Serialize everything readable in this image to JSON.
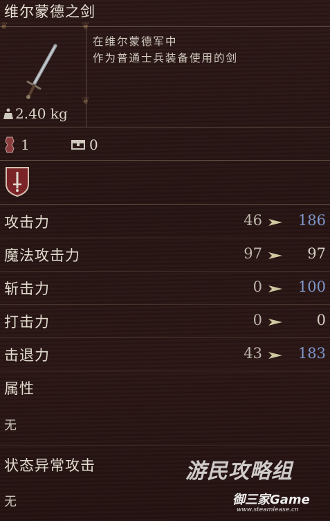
{
  "item": {
    "name": "维尔蒙德之剑",
    "description_lines": [
      "在维尔蒙德军中",
      "作为普通士兵装备使用的剑"
    ],
    "weight": "2.40 kg",
    "slots": {
      "hand_count": "1",
      "storage_count": "0"
    },
    "class_icon": "sword-emblem-icon"
  },
  "stats": [
    {
      "label": "攻击力",
      "base": "46",
      "upgraded": "186",
      "improved": true
    },
    {
      "label": "魔法攻击力",
      "base": "97",
      "upgraded": "97",
      "improved": false
    },
    {
      "label": "斩击力",
      "base": "0",
      "upgraded": "100",
      "improved": true
    },
    {
      "label": "打击力",
      "base": "0",
      "upgraded": "0",
      "improved": false
    },
    {
      "label": "击退力",
      "base": "43",
      "upgraded": "183",
      "improved": true
    }
  ],
  "attribute": {
    "label": "属性",
    "value": "无"
  },
  "status_attack": {
    "label": "状态异常攻击",
    "value": "无"
  },
  "watermark": {
    "brand": "游民攻略组",
    "site_name": "御三家Game",
    "site_url": "www.steamlease.cn"
  },
  "colors": {
    "improved_value": "#7f97c9",
    "background": "#2a1716",
    "divider": "#bea98c"
  }
}
